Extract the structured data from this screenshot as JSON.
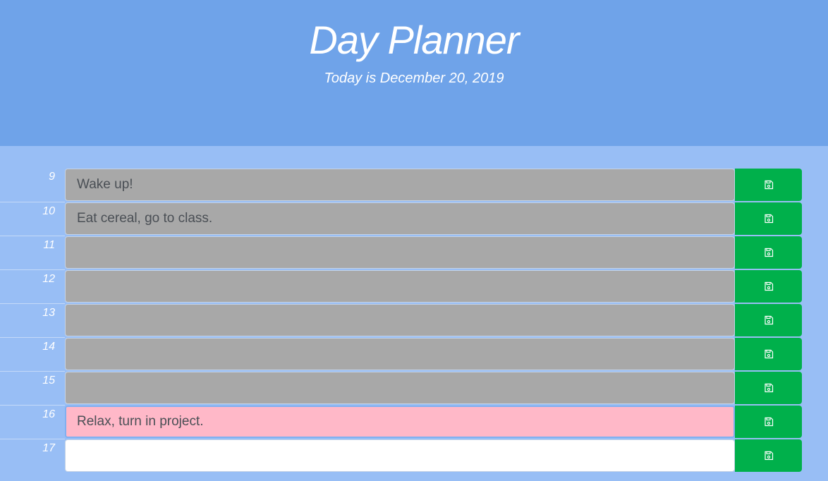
{
  "header": {
    "title": "Day Planner",
    "date": "Today is December 20, 2019"
  },
  "rows": [
    {
      "hour": "9",
      "text": "Wake up!",
      "state": "past"
    },
    {
      "hour": "10",
      "text": "Eat cereal, go to class.",
      "state": "past"
    },
    {
      "hour": "11",
      "text": "",
      "state": "past"
    },
    {
      "hour": "12",
      "text": "",
      "state": "past"
    },
    {
      "hour": "13",
      "text": "",
      "state": "past"
    },
    {
      "hour": "14",
      "text": "",
      "state": "past"
    },
    {
      "hour": "15",
      "text": "",
      "state": "past"
    },
    {
      "hour": "16",
      "text": "Relax, turn in project.",
      "state": "present"
    },
    {
      "hour": "17",
      "text": "",
      "state": "future"
    }
  ],
  "icons": {
    "save": "save-icon"
  },
  "colors": {
    "header_bg": "#6fa3e9",
    "page_bg": "#98bef5",
    "past": "#a8a8a8",
    "present": "#ffb8c8",
    "future": "#ffffff",
    "save_button": "#00b04b"
  }
}
